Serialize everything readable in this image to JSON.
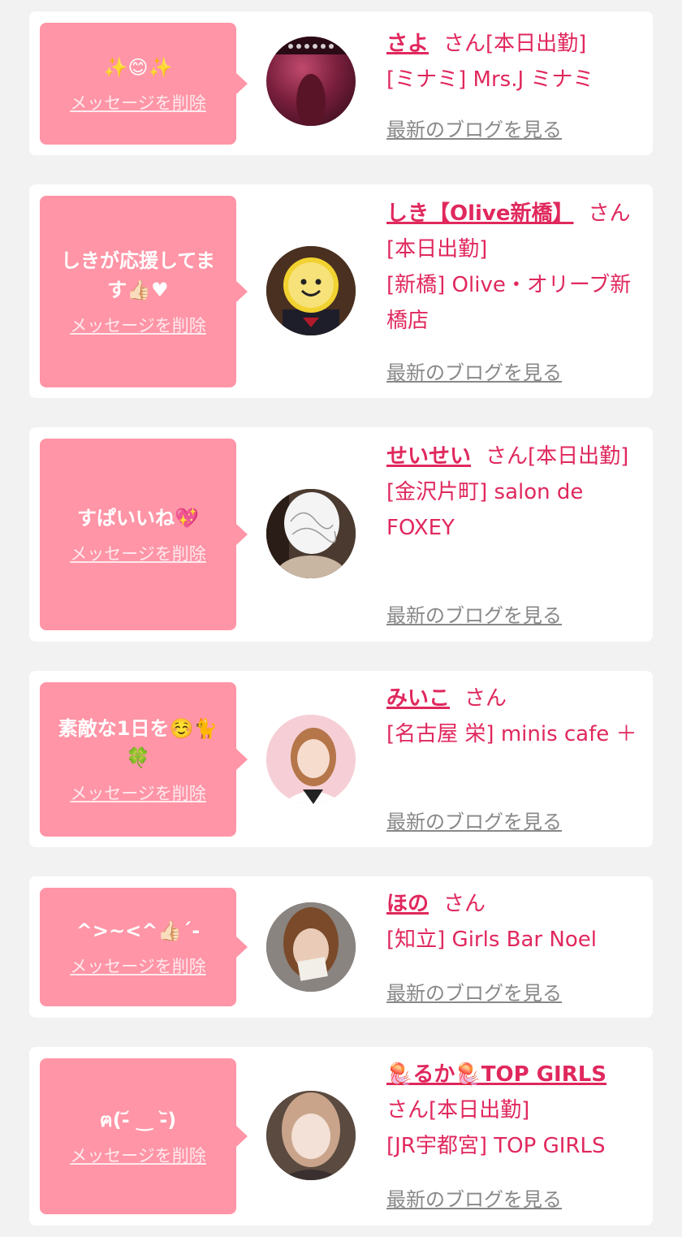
{
  "cards": [
    {
      "message_lines": [
        "✨😊✨"
      ],
      "delete_label": "メッセージを削除",
      "name": "さよ",
      "honorific": "さん[本日出勤]",
      "shop": "[ミナミ] Mrs.J ミナミ",
      "blog_label": "最新のブログを見る",
      "avatar_desc": "photo"
    },
    {
      "message_lines": [
        "しきが応援してま",
        "す👍🏻♥"
      ],
      "delete_label": "メッセージを削除",
      "name": "しき【Olive新橋】",
      "honorific": "さん[本日出勤]",
      "shop": "[新橋] Olive・オリーブ新橋店",
      "blog_label": "最新のブログを見る",
      "avatar_desc": "photo"
    },
    {
      "message_lines": [
        "すぱいいね💖"
      ],
      "delete_label": "メッセージを削除",
      "name": "せいせい",
      "honorific": "さん[本日出勤]",
      "shop": "[金沢片町] salon de FOXEY",
      "blog_label": "最新のブログを見る",
      "avatar_desc": "photo"
    },
    {
      "message_lines": [
        "素敵な1日を☺️🐈",
        "🍀"
      ],
      "delete_label": "メッセージを削除",
      "name": "みいこ",
      "honorific": "さん",
      "shop": "[名古屋 栄] minis cafe ＋",
      "blog_label": "最新のブログを見る",
      "avatar_desc": "photo"
    },
    {
      "message_lines": [
        "^>~<^👍🏻´-"
      ],
      "delete_label": "メッセージを削除",
      "name": "ほの",
      "honorific": "さん",
      "shop": "[知立] Girls Bar Noel",
      "blog_label": "最新のブログを見る",
      "avatar_desc": "photo"
    },
    {
      "message_lines": [
        "ฅ(-᷄ ‿ -᷅)"
      ],
      "delete_label": "メッセージを削除",
      "name": "🪼るか🪼TOP GIRLS",
      "honorific": "さん[本日出勤]",
      "shop": "[JR宇都宮] TOP GIRLS",
      "blog_label": "最新のブログを見る",
      "avatar_desc": "photo"
    }
  ],
  "colors": {
    "accent": "#e0285d",
    "bubble": "#ff95a6",
    "background": "#f2f2f2",
    "link_gray": "#888888"
  }
}
